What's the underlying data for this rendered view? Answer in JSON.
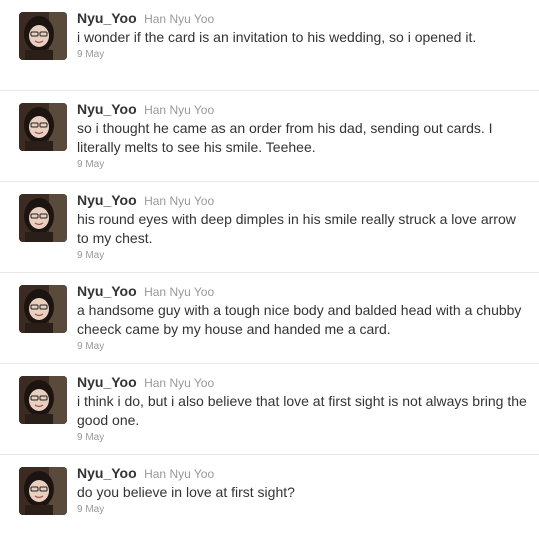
{
  "tweets": [
    {
      "screen_name": "Nyu_Yoo",
      "full_name": "Han Nyu Yoo",
      "text": "i wonder if the card is an invitation to his wedding, so i opened it.",
      "time": "9 May"
    },
    {
      "screen_name": "Nyu_Yoo",
      "full_name": "Han Nyu Yoo",
      "text": "so i thought he came as an order from his dad, sending out cards. I literally melts to see his smile. Teehee.",
      "time": "9 May"
    },
    {
      "screen_name": "Nyu_Yoo",
      "full_name": "Han Nyu Yoo",
      "text": "his round eyes with deep dimples in his smile really struck a love arrow to my chest.",
      "time": "9 May"
    },
    {
      "screen_name": "Nyu_Yoo",
      "full_name": "Han Nyu Yoo",
      "text": "a handsome guy with a tough nice body and balded head with a chubby cheeck came by my house and handed me a card.",
      "time": "9 May"
    },
    {
      "screen_name": "Nyu_Yoo",
      "full_name": "Han Nyu Yoo",
      "text": "i think i do, but i also believe that love at first sight is not always bring the good one.",
      "time": "9 May"
    },
    {
      "screen_name": "Nyu_Yoo",
      "full_name": "Han Nyu Yoo",
      "text": "do you believe in love at first sight?",
      "time": "9 May"
    }
  ]
}
